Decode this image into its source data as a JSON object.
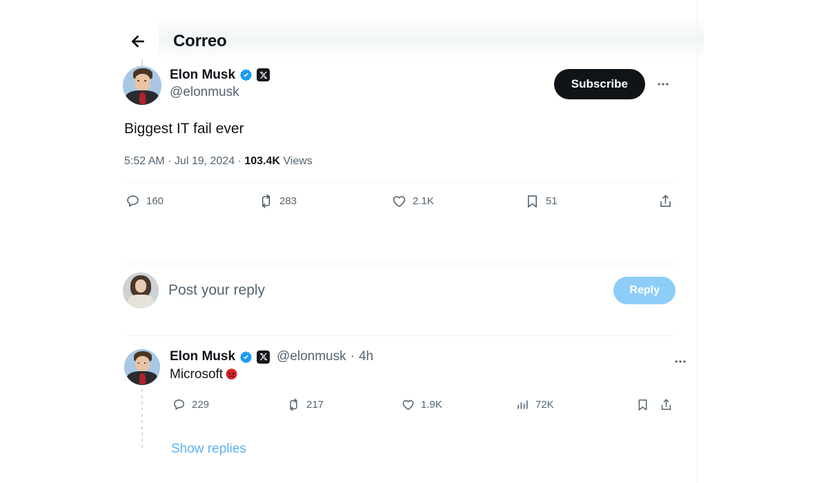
{
  "header": {
    "title": "Correo",
    "back_icon": "arrow-left-icon"
  },
  "tweet": {
    "author": {
      "display_name": "Elon Musk",
      "handle": "@elonmusk",
      "verified_badge": "verified-badge-icon",
      "affiliate_badge": "x-badge-icon",
      "avatar": "elon-musk-avatar"
    },
    "subscribe_label": "Subscribe",
    "more_icon": "more-horizontal-icon",
    "text": "Biggest IT fail ever",
    "meta": {
      "time": "5:52 AM",
      "separator": " · ",
      "date": "Jul 19, 2024",
      "views_count": "103.4K",
      "views_label": "Views"
    },
    "actions": {
      "reply_count": "160",
      "retweet_count": "283",
      "like_count": "2.1K",
      "bookmark_count": "51",
      "share_icon": "share-icon",
      "reply_icon": "comment-icon",
      "retweet_icon": "retweet-icon",
      "like_icon": "heart-icon",
      "bookmark_icon": "bookmark-icon"
    }
  },
  "composer": {
    "placeholder": "Post your reply",
    "reply_button_label": "Reply",
    "avatar": "user-avatar"
  },
  "reply": {
    "author": {
      "display_name": "Elon Musk",
      "handle": "@elonmusk",
      "verified_badge": "verified-badge-icon",
      "affiliate_badge": "x-badge-icon",
      "avatar": "elon-musk-avatar"
    },
    "timestamp_separator": "·",
    "timestamp": "4h",
    "more_icon": "more-horizontal-icon",
    "text": "Microsoft",
    "emoji": "angry-face-emoji",
    "actions": {
      "reply_count": "229",
      "retweet_count": "217",
      "like_count": "1.9K",
      "views_count": "72K",
      "views_icon": "analytics-icon",
      "bookmark_icon": "bookmark-icon",
      "share_icon": "share-icon"
    },
    "show_replies_label": "Show replies"
  },
  "colors": {
    "accent_blue": "#5ab2f2",
    "verified_blue": "#1d9bf0",
    "reply_button": "#8ecdf8",
    "text_primary": "#0f1419",
    "text_secondary": "#536471",
    "border": "#eff3f4",
    "subscribe_bg": "#0f1419"
  }
}
